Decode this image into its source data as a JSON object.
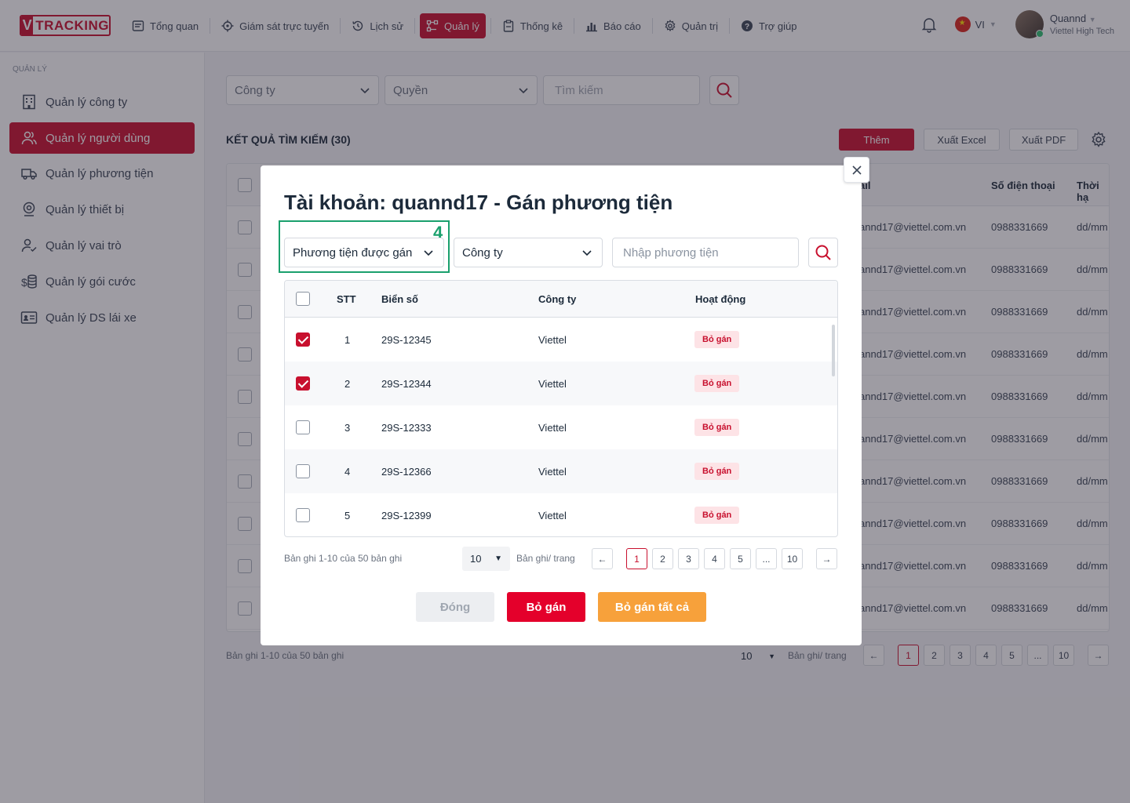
{
  "app": {
    "logo_v": "V",
    "logo_text": "TRACKING"
  },
  "nav": [
    {
      "label": "Tổng quan",
      "icon": "dashboard-icon"
    },
    {
      "label": "Giám sát trực tuyến",
      "icon": "target-icon"
    },
    {
      "label": "Lịch sử",
      "icon": "history-icon"
    },
    {
      "label": "Quản lý",
      "icon": "manage-icon",
      "active": true
    },
    {
      "label": "Thống kê",
      "icon": "clipboard-icon"
    },
    {
      "label": "Báo cáo",
      "icon": "chart-icon"
    },
    {
      "label": "Quản trị",
      "icon": "gear-icon"
    },
    {
      "label": "Trợ giúp",
      "icon": "help-icon"
    }
  ],
  "header": {
    "lang": "VI",
    "user_name": "Quannd",
    "user_org": "Viettel High Tech"
  },
  "sidebar": {
    "title": "QUẢN LÝ",
    "items": [
      {
        "label": "Quản lý công ty"
      },
      {
        "label": "Quản lý người dùng"
      },
      {
        "label": "Quản lý phương tiện"
      },
      {
        "label": "Quản lý thiết bị"
      },
      {
        "label": "Quản lý vai trò"
      },
      {
        "label": "Quản lý gói cước"
      },
      {
        "label": "Quản lý DS lái xe"
      }
    ]
  },
  "main": {
    "filter_company": "Công ty",
    "filter_role": "Quyền",
    "search_placeholder": "Tìm kiếm",
    "results_title": "KẾT QUẢ TÌM KIẾM (30)",
    "btn_add": "Thêm",
    "btn_excel": "Xuất Excel",
    "btn_pdf": "Xuất PDF",
    "col_email": "ail",
    "col_phone": "Số điện thoại",
    "col_time": "Thời hạ",
    "row_email": "annd17@viettel.com.vn",
    "row_phone": "0988331669",
    "row_time": "dd/mm",
    "info": "Bản ghi 1-10 của 50 bản ghi",
    "page_size": "10",
    "per_page": "Bản ghi/ trang",
    "pages": [
      "1",
      "2",
      "3",
      "4",
      "5",
      "...",
      "10"
    ]
  },
  "modal": {
    "title": "Tài khoản: quannd17  -  Gán phương tiện",
    "step": "4",
    "filter_assigned": "Phương tiện được gán",
    "filter_company": "Công ty",
    "search_placeholder": "Nhập phương tiện",
    "columns": {
      "stt": "STT",
      "plate": "Biển số",
      "company": "Công ty",
      "action": "Hoạt động"
    },
    "rows": [
      {
        "stt": "1",
        "plate": "29S-12345",
        "company": "Viettel",
        "action": "Bỏ gán",
        "checked": true
      },
      {
        "stt": "2",
        "plate": "29S-12344",
        "company": "Viettel",
        "action": "Bỏ gán",
        "checked": true
      },
      {
        "stt": "3",
        "plate": "29S-12333",
        "company": "Viettel",
        "action": "Bỏ gán",
        "checked": false
      },
      {
        "stt": "4",
        "plate": "29S-12366",
        "company": "Viettel",
        "action": "Bỏ gán",
        "checked": false
      },
      {
        "stt": "5",
        "plate": "29S-12399",
        "company": "Viettel",
        "action": "Bỏ gán",
        "checked": false
      }
    ],
    "info": "Bản ghi 1-10 của 50 bản ghi",
    "page_size": "10",
    "per_page": "Bản ghi/ trang",
    "pages": [
      "1",
      "2",
      "3",
      "4",
      "5",
      "...",
      "10"
    ],
    "btn_close": "Đóng",
    "btn_unassign": "Bỏ gán",
    "btn_unassign_all": "Bỏ gán tất cả"
  },
  "colors": {
    "brand": "#c8102e",
    "accent_orange": "#f7a13b",
    "highlight_green": "#1aa06d"
  }
}
